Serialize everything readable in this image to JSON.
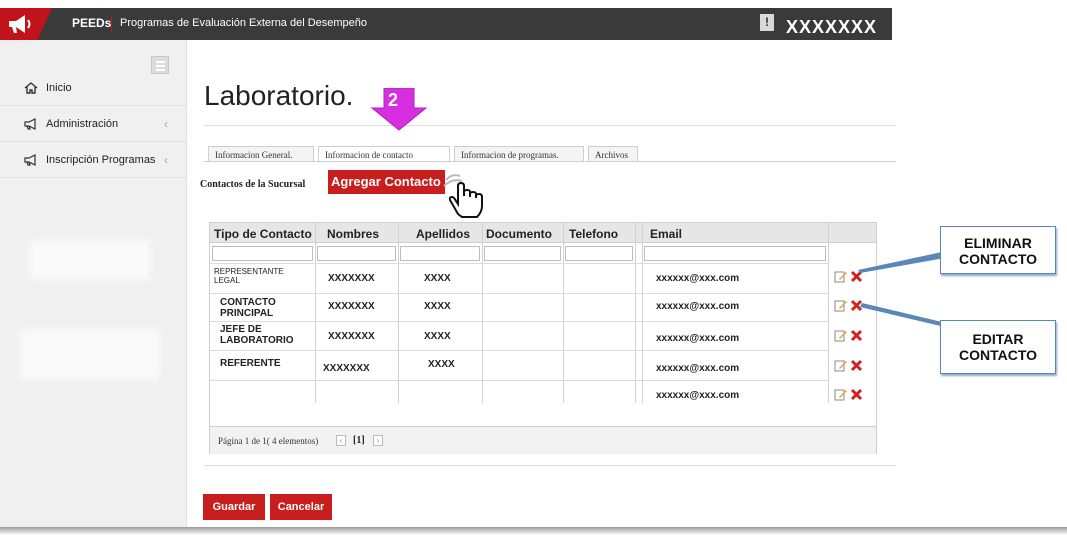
{
  "topbar": {
    "app_name": "PEEDs",
    "subtitle": "Programas de Evaluación Externa del Desempeño",
    "user": "XXXXXXX"
  },
  "sidebar": {
    "items": [
      {
        "label": "Inicio",
        "icon": "home-icon"
      },
      {
        "label": "Administración",
        "icon": "megaphone-icon"
      },
      {
        "label": "Inscripción Programas",
        "icon": "megaphone-icon"
      }
    ]
  },
  "page": {
    "title": "Laboratorio."
  },
  "tabs": [
    {
      "label": "Informacion General."
    },
    {
      "label": "Informacion de contacto",
      "active": true
    },
    {
      "label": "Informacion de programas."
    },
    {
      "label": "Archivos"
    }
  ],
  "contacts": {
    "section_label": "Contactos de la Sucursal",
    "add_button": "Agregar Contacto",
    "columns": [
      "Tipo de Contacto",
      "Nombres",
      "Apellidos",
      "Documento",
      "Telefono",
      "Email"
    ],
    "rows": [
      {
        "tipo": "REPRESENTANTE LEGAL",
        "nombres": "XXXXXXX",
        "apellidos": "XXXX",
        "email": "xxxxxx@xxx.com"
      },
      {
        "tipo": "CONTACTO PRINCIPAL",
        "nombres": "XXXXXXX",
        "apellidos": "XXXX",
        "email": "xxxxxx@xxx.com"
      },
      {
        "tipo": "JEFE DE LABORATORIO",
        "nombres": "XXXXXXX",
        "apellidos": "XXXX",
        "email": "xxxxxx@xxx.com"
      },
      {
        "tipo": "REFERENTE",
        "nombres": "XXXXXXX",
        "apellidos": "XXXX",
        "email": "xxxxxx@xxx.com"
      },
      {
        "tipo": "",
        "nombres": "",
        "apellidos": "",
        "email": "xxxxxx@xxx.com"
      }
    ],
    "pager": {
      "text": "Página 1 de 1( 4 elementos)",
      "current": "[1]"
    }
  },
  "actions": {
    "save": "Guardar",
    "cancel": "Cancelar"
  },
  "annotations": {
    "step_number": "2",
    "delete_label": "ELIMINAR CONTACTO",
    "edit_label": "EDITAR CONTACTO"
  },
  "colors": {
    "brand_red": "#c81e1e",
    "topbar": "#3a3a3a",
    "arrow_magenta": "#d62ee0",
    "callout_border": "#5b86b8"
  }
}
